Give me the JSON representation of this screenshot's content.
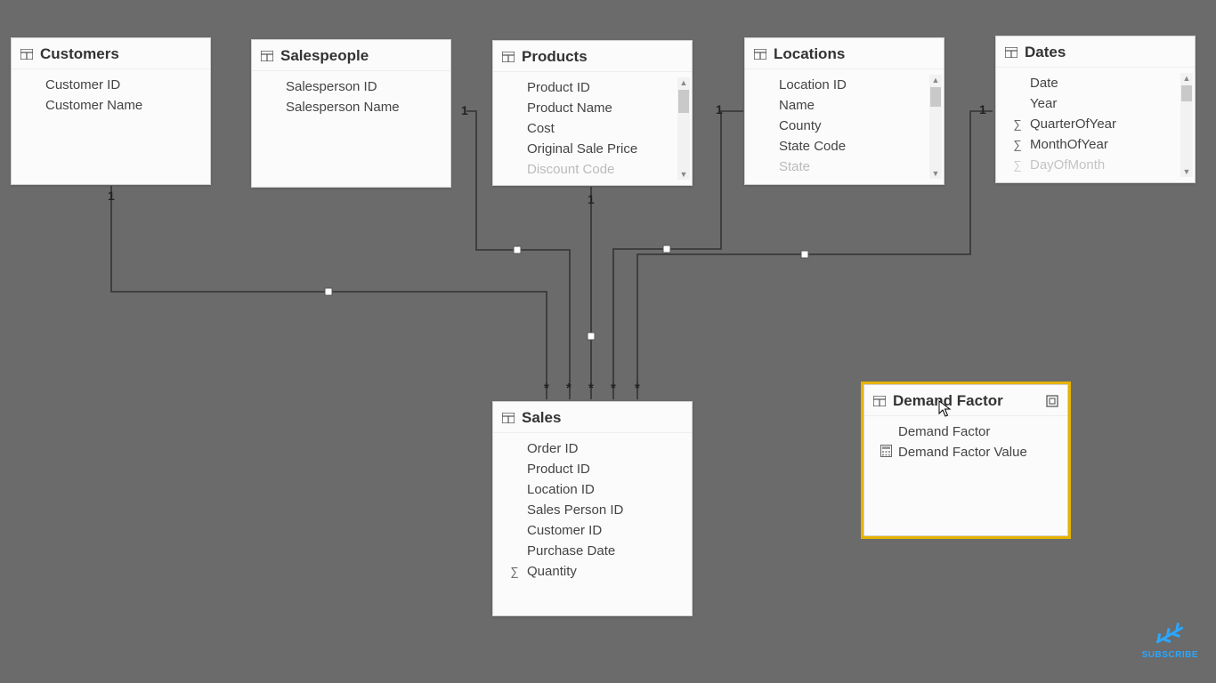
{
  "tables": {
    "customers": {
      "title": "Customers",
      "fields": [
        {
          "icon": "",
          "label": "Customer ID"
        },
        {
          "icon": "",
          "label": "Customer Name"
        }
      ]
    },
    "salespeople": {
      "title": "Salespeople",
      "fields": [
        {
          "icon": "",
          "label": "Salesperson ID"
        },
        {
          "icon": "",
          "label": "Salesperson Name"
        }
      ]
    },
    "products": {
      "title": "Products",
      "fields": [
        {
          "icon": "",
          "label": "Product ID"
        },
        {
          "icon": "",
          "label": "Product Name"
        },
        {
          "icon": "",
          "label": "Cost"
        },
        {
          "icon": "",
          "label": "Original Sale Price"
        },
        {
          "icon": "",
          "label": "Discount Code"
        }
      ]
    },
    "locations": {
      "title": "Locations",
      "fields": [
        {
          "icon": "",
          "label": "Location ID"
        },
        {
          "icon": "",
          "label": "Name"
        },
        {
          "icon": "",
          "label": "County"
        },
        {
          "icon": "",
          "label": "State Code"
        },
        {
          "icon": "",
          "label": "State"
        }
      ]
    },
    "dates": {
      "title": "Dates",
      "fields": [
        {
          "icon": "",
          "label": "Date"
        },
        {
          "icon": "",
          "label": "Year"
        },
        {
          "icon": "sigma",
          "label": "QuarterOfYear"
        },
        {
          "icon": "sigma",
          "label": "MonthOfYear"
        },
        {
          "icon": "sigma",
          "label": "DayOfMonth"
        }
      ]
    },
    "sales": {
      "title": "Sales",
      "fields": [
        {
          "icon": "",
          "label": "Order ID"
        },
        {
          "icon": "",
          "label": "Product ID"
        },
        {
          "icon": "",
          "label": "Location ID"
        },
        {
          "icon": "",
          "label": "Sales Person ID"
        },
        {
          "icon": "",
          "label": "Customer ID"
        },
        {
          "icon": "",
          "label": "Purchase Date"
        },
        {
          "icon": "sigma",
          "label": "Quantity"
        }
      ]
    },
    "demand": {
      "title": "Demand Factor",
      "fields": [
        {
          "icon": "",
          "label": "Demand Factor"
        },
        {
          "icon": "calc",
          "label": "Demand Factor Value"
        }
      ]
    }
  },
  "cardinality": {
    "one": "1",
    "many": "*"
  },
  "subscribe": "SUBSCRIBE"
}
